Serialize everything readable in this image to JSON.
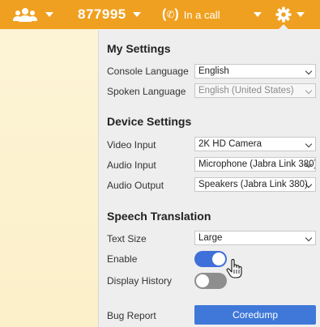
{
  "topbar": {
    "number": "877995",
    "call_icon": "phone-icon",
    "call_status": "In a call"
  },
  "settings": {
    "my_settings": {
      "title": "My Settings",
      "console_language_label": "Console Language",
      "console_language_value": "English",
      "spoken_language_label": "Spoken Language",
      "spoken_language_value": "English (United States)"
    },
    "device_settings": {
      "title": "Device Settings",
      "video_input_label": "Video Input",
      "video_input_value": "2K HD Camera",
      "audio_input_label": "Audio Input",
      "audio_input_value": "Microphone (Jabra Link 380)",
      "audio_output_label": "Audio Output",
      "audio_output_value": "Speakers (Jabra Link 380)"
    },
    "speech_translation": {
      "title": "Speech Translation",
      "text_size_label": "Text Size",
      "text_size_value": "Large",
      "enable_label": "Enable",
      "enable_on": true,
      "display_history_label": "Display History",
      "display_history_on": false
    },
    "bug_report_label": "Bug Report",
    "coredump_button": "Coredump"
  },
  "colors": {
    "topbar": "#f0a020",
    "toggle_on": "#3f6fd8",
    "toggle_off": "#8e8e8e",
    "button": "#3f78d8"
  }
}
